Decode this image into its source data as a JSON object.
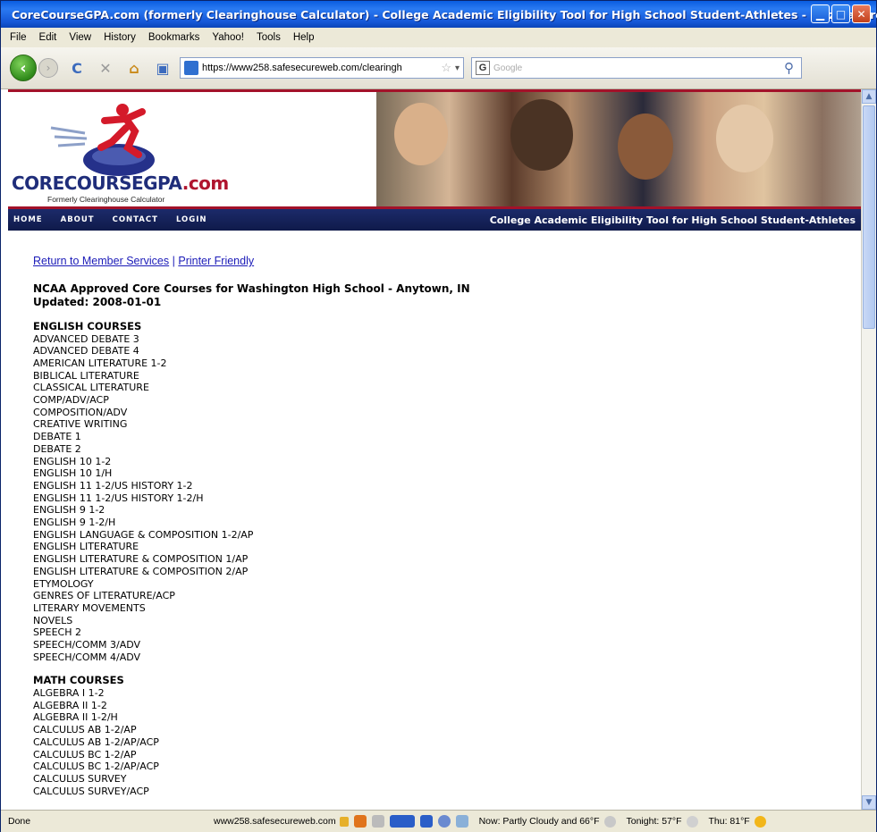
{
  "window": {
    "title": "CoreCourseGPA.com (formerly Clearinghouse Calculator) - College Academic Eligibility Tool for High School Student-Athletes - Mozilla Firefox"
  },
  "menu": [
    "File",
    "Edit",
    "View",
    "History",
    "Bookmarks",
    "Yahoo!",
    "Tools",
    "Help"
  ],
  "toolbar": {
    "url": "https://www258.safesecureweb.com/clearingh",
    "search_placeholder": "Google"
  },
  "site": {
    "logo_title": "CORECOURSEGPA",
    "logo_tld": ".com",
    "logo_subtitle": "Formerly Clearinghouse Calculator",
    "nav": [
      "HOME",
      "ABOUT",
      "CONTACT",
      "LOGIN"
    ],
    "tagline": "College Academic Eligibility Tool for High School Student-Athletes"
  },
  "content": {
    "return_link": "Return to Member Services",
    "separator": "|",
    "printer_link": "Printer Friendly",
    "heading_line1": "NCAA Approved Core Courses for Washington High School - Anytown, IN",
    "heading_line2": "Updated: 2008-01-01",
    "sections": [
      {
        "title": "ENGLISH COURSES",
        "courses": [
          "ADVANCED DEBATE 3",
          "ADVANCED DEBATE 4",
          "AMERICAN LITERATURE 1-2",
          "BIBLICAL LITERATURE",
          "CLASSICAL LITERATURE",
          "COMP/ADV/ACP",
          "COMPOSITION/ADV",
          "CREATIVE WRITING",
          "DEBATE 1",
          "DEBATE 2",
          "ENGLISH 10 1-2",
          "ENGLISH 10 1/H",
          "ENGLISH 11 1-2/US HISTORY 1-2",
          "ENGLISH 11 1-2/US HISTORY 1-2/H",
          "ENGLISH 9 1-2",
          "ENGLISH 9 1-2/H",
          "ENGLISH LANGUAGE & COMPOSITION 1-2/AP",
          "ENGLISH LITERATURE",
          "ENGLISH LITERATURE & COMPOSITION 1/AP",
          "ENGLISH LITERATURE & COMPOSITION 2/AP",
          "ETYMOLOGY",
          "GENRES OF LITERATURE/ACP",
          "LITERARY MOVEMENTS",
          "NOVELS",
          "SPEECH 2",
          "SPEECH/COMM 3/ADV",
          "SPEECH/COMM 4/ADV"
        ]
      },
      {
        "title": "MATH COURSES",
        "courses": [
          "ALGEBRA I 1-2",
          "ALGEBRA II 1-2",
          "ALGEBRA II 1-2/H",
          "CALCULUS AB 1-2/AP",
          "CALCULUS AB 1-2/AP/ACP",
          "CALCULUS BC 1-2/AP",
          "CALCULUS BC 1-2/AP/ACP",
          "CALCULUS SURVEY",
          "CALCULUS SURVEY/ACP"
        ]
      }
    ]
  },
  "statusbar": {
    "status": "Done",
    "host": "www258.safesecureweb.com",
    "weather_now": "Now: Partly Cloudy and 66°F",
    "weather_tonight": "Tonight: 57°F",
    "weather_thu": "Thu: 81°F"
  }
}
